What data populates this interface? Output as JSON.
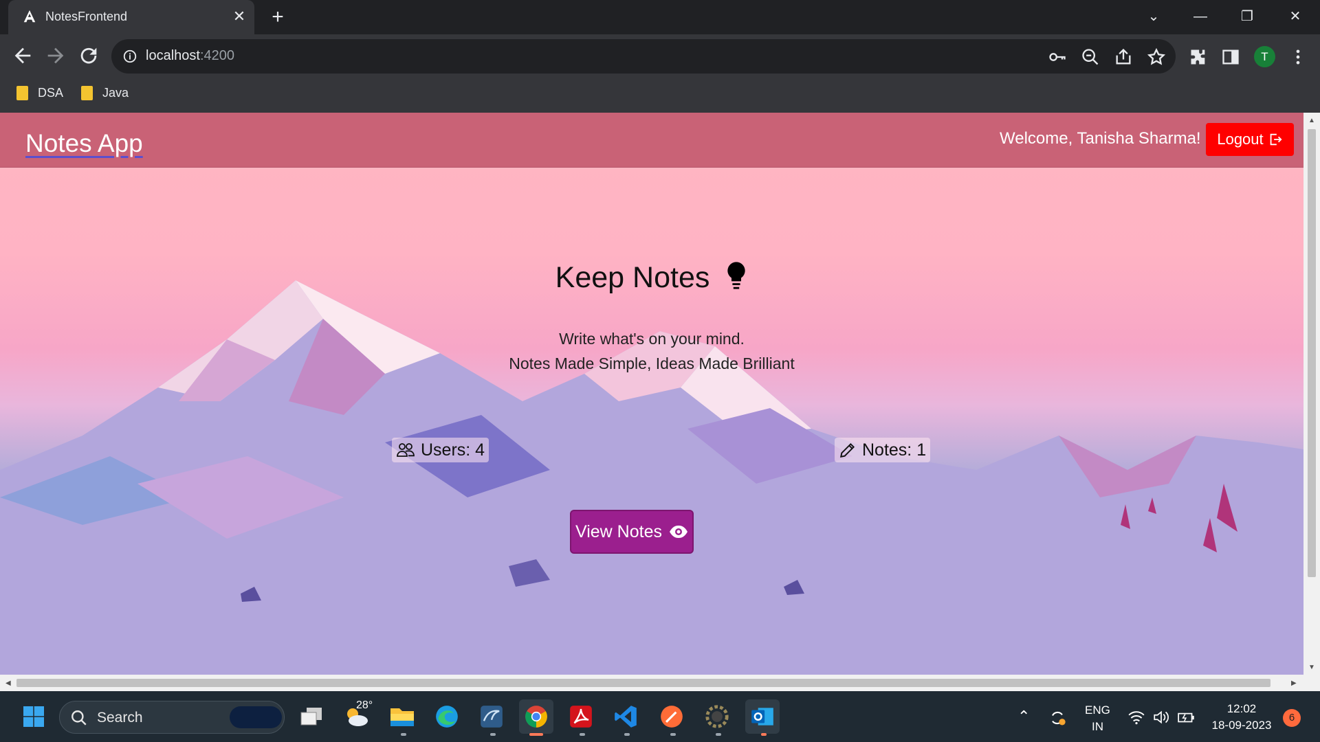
{
  "browser": {
    "tab_title": "NotesFrontend",
    "tab_close": "✕",
    "new_tab": "+",
    "url_host": "localhost",
    "url_port": ":4200",
    "bookmarks": [
      {
        "label": "DSA"
      },
      {
        "label": "Java"
      }
    ],
    "profile_initial": "T"
  },
  "app": {
    "brand": "Notes App",
    "welcome": "Welcome, Tanisha Sharma!",
    "logout_label": "Logout",
    "heading": "Keep Notes",
    "tagline_1": "Write what's on your mind.",
    "tagline_2": "Notes Made Simple, Ideas Made Brilliant",
    "users_stat": "Users: 4",
    "notes_stat": "Notes: 1",
    "view_notes_label": "View Notes",
    "colors": {
      "navbar": "#c96276",
      "logout": "#ff0000",
      "view_button": "#9b1f8e"
    }
  },
  "taskbar": {
    "search_label": "Search",
    "weather_temp": "28°",
    "language_1": "ENG",
    "language_2": "IN",
    "time": "12:02",
    "date": "18-09-2023",
    "notification_count": "6",
    "apps": [
      "windows-start",
      "task-view",
      "weather",
      "file-explorer",
      "edge",
      "mysql-workbench",
      "chrome",
      "acrobat",
      "vscode",
      "postman",
      "settings",
      "outlook"
    ]
  }
}
